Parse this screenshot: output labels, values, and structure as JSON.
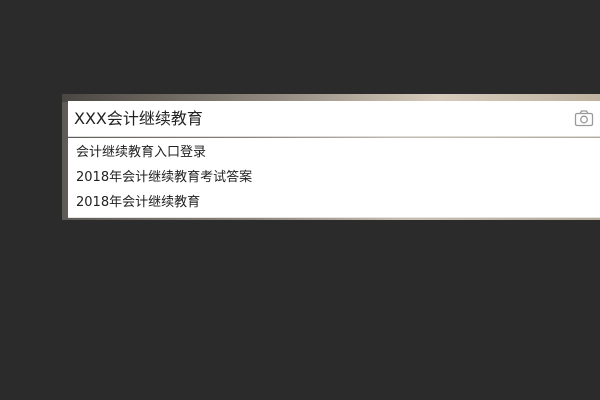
{
  "search": {
    "value": "XXX会计继续教育",
    "camera_icon": "camera-icon"
  },
  "suggestions": [
    {
      "label": "会计继续教育入口登录"
    },
    {
      "label": "2018年会计继续教育考试答案"
    },
    {
      "label": "2018年会计继续教育"
    }
  ]
}
